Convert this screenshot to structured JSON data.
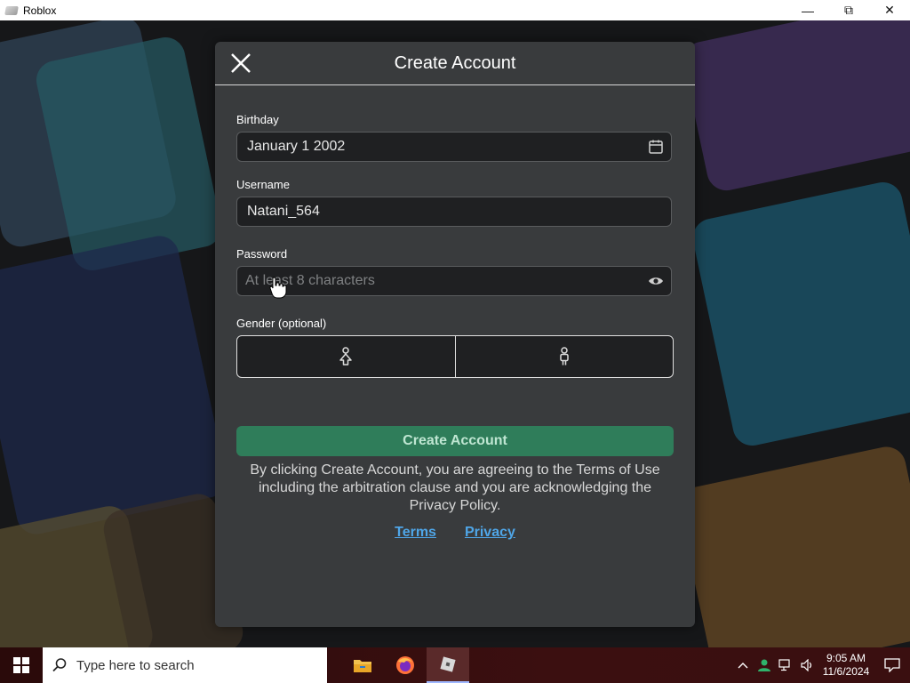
{
  "window": {
    "title": "Roblox"
  },
  "dialog": {
    "title": "Create Account",
    "birthday": {
      "label": "Birthday",
      "value": "January 1 2002"
    },
    "username": {
      "label": "Username",
      "value": "Natani_564"
    },
    "password": {
      "label": "Password",
      "placeholder": "At least 8 characters"
    },
    "gender": {
      "label": "Gender (optional)"
    },
    "submit_label": "Create Account",
    "legal_text": "By clicking Create Account, you are agreeing to the Terms of Use including the arbitration clause and you are acknowledging the Privacy Policy.",
    "links": {
      "terms": "Terms",
      "privacy": "Privacy"
    }
  },
  "taskbar": {
    "search_placeholder": "Type here to search",
    "time": "9:05 AM",
    "date": "11/6/2024"
  },
  "colors": {
    "dialog_bg": "#393b3d",
    "primary_button": "#2f7d5a",
    "link": "#4fa6e8"
  },
  "icons": [
    "close-icon",
    "calendar-icon",
    "eye-icon",
    "female-icon",
    "male-icon",
    "windows-start-icon",
    "search-icon",
    "file-explorer-icon",
    "firefox-icon",
    "roblox-icon"
  ]
}
